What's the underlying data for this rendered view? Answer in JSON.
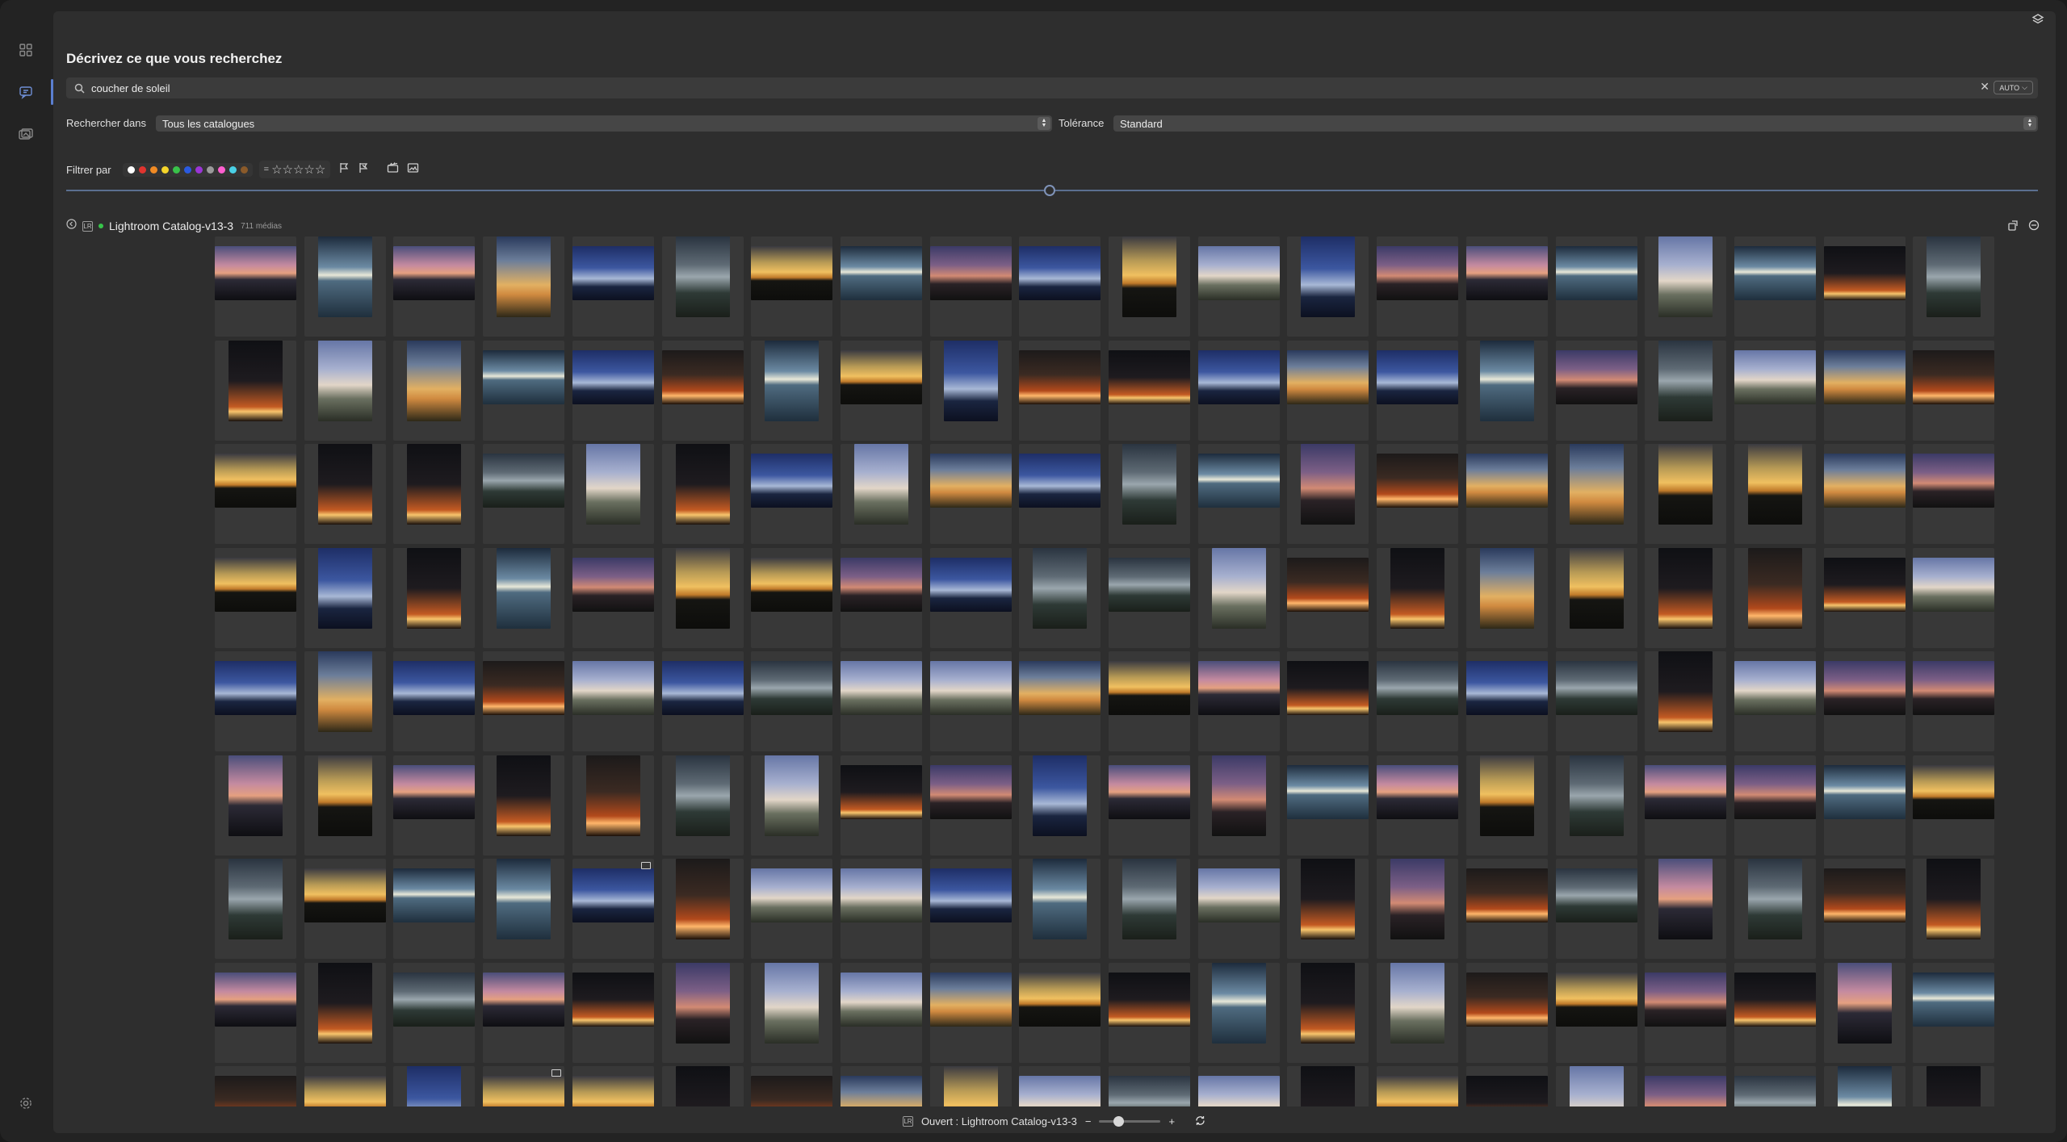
{
  "search": {
    "title": "Décrivez ce que vous recherchez",
    "query": "coucher de soleil",
    "mode": "AUTO"
  },
  "options": {
    "search_in_label": "Rechercher dans",
    "search_in_value": "Tous les catalogues",
    "tolerance_label": "Tolérance",
    "tolerance_value": "Standard",
    "filter_label": "Filtrer par",
    "rating_prefix": "=",
    "rating_stars": "☆☆☆☆☆"
  },
  "color_filters": [
    "#ffffff",
    "#e0342f",
    "#f08a24",
    "#f5d52a",
    "#39c24a",
    "#2a5ae0",
    "#9b35d6",
    "#9a9a9a",
    "#ff5fd0",
    "#4ad0e6",
    "#8a5a2a"
  ],
  "catalog": {
    "name": "Lightroom Catalog-v13-3",
    "count": "711 médias",
    "badge": "LR"
  },
  "status": {
    "opened_text": "Ouvert : Lightroom Catalog-v13-3",
    "zoom_minus": "−",
    "zoom_plus": "+"
  },
  "grid": {
    "columns": 20,
    "rows": 9,
    "media_type_names": [
      "gold",
      "dusk",
      "sea",
      "dark",
      "blue",
      "pinkcloud",
      "fire",
      "cloudy",
      "yellowsky",
      "dawnpale"
    ]
  }
}
